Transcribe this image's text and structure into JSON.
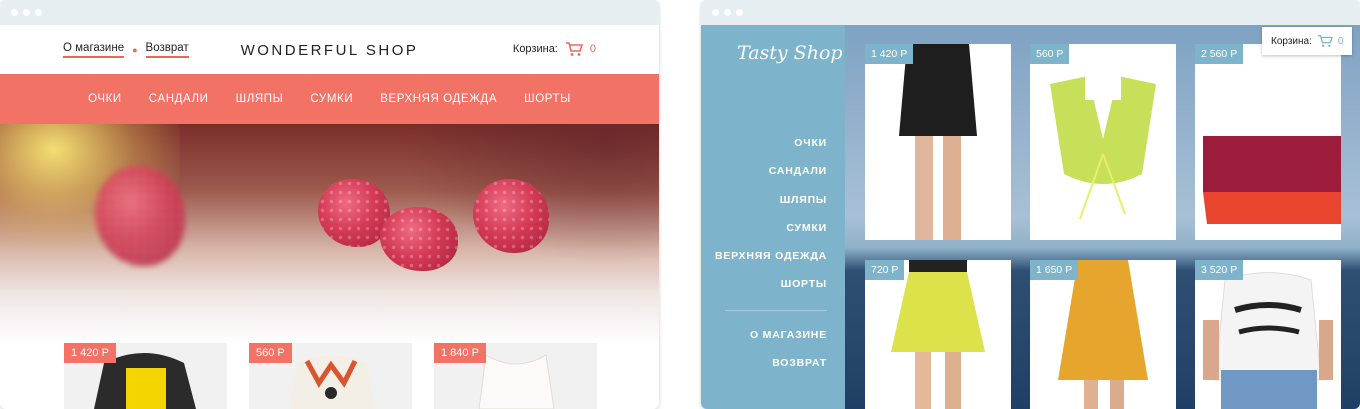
{
  "left": {
    "top_links": [
      "О магазине",
      "Возврат"
    ],
    "brand": "WONDERFUL SHOP",
    "cart": {
      "label": "Корзина:",
      "count": "0"
    },
    "nav": [
      "ОЧКИ",
      "САНДАЛИ",
      "ШЛЯПЫ",
      "СУМКИ",
      "ВЕРХНЯЯ ОДЕЖДА",
      "ШОРТЫ"
    ],
    "products": [
      {
        "price": "1 420 Р"
      },
      {
        "price": "560 Р"
      },
      {
        "price": "1 840 Р"
      }
    ],
    "accent": "#f37266"
  },
  "right": {
    "logo": "Tasty Shop",
    "menu": [
      "ОЧКИ",
      "САНДАЛИ",
      "ШЛЯПЫ",
      "СУМКИ",
      "ВЕРХНЯЯ ОДЕЖДА",
      "ШОРТЫ"
    ],
    "menu_secondary": [
      "О МАГАЗИНЕ",
      "ВОЗВРАТ"
    ],
    "cart": {
      "label": "Корзина:",
      "count": "0"
    },
    "products": [
      {
        "price": "1 420 Р"
      },
      {
        "price": "560 Р"
      },
      {
        "price": "2 560 Р"
      },
      {
        "price": "720 Р"
      },
      {
        "price": "1 650 Р"
      },
      {
        "price": "3 520 Р"
      }
    ],
    "accent": "#7db4cc"
  }
}
